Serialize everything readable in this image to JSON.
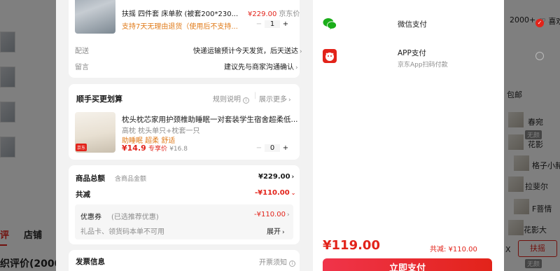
{
  "background": {
    "tabs": [
      "评",
      "店铺"
    ],
    "review_title": "织评价(2000+",
    "cart_count": "2000+",
    "like_label": "喜欢",
    "right_items": [
      "包邮",
      "春宛",
      "花影",
      "格子小赭",
      "拉斐尔",
      "F菩情",
      "花影",
      "无颜",
      "无颜",
      "无颜"
    ],
    "follow_button": "扶摇",
    "right_note": "花影大",
    "stray_char": "X"
  },
  "product": {
    "spec": "扶摇   四件套  床单款   (被套200*230...",
    "price": "¥229.00",
    "seller": "京东价",
    "return_policy": "支持7天无理由退货（使用后不支持...",
    "qty": "1",
    "minus": "−",
    "plus": "+",
    "delivery_label": "配送",
    "delivery_value": "快递运输预计今天发货，后天送达",
    "note_label": "留言",
    "note_value": "建议先与商家沟通确认"
  },
  "bundle": {
    "title": "顺手买更划算",
    "rules": "规则说明",
    "more": "展示更多",
    "name": "枕头枕芯家用护颈椎助睡眠一对套装学生宿舍超柔低...",
    "spec": "高枕  枕头单只+枕套一只",
    "tags": "助睡眠  超柔  舒适",
    "price": "¥14.9",
    "price_label": "专享价",
    "old_price": "¥16.8",
    "qty": "0",
    "minus": "−",
    "plus": "+",
    "tag": "京东"
  },
  "totals": {
    "goods_label": "商品总额",
    "goods_sub": "含商品金额",
    "goods_value": "¥229.00",
    "discount_label": "共减",
    "discount_value": "-¥110.00",
    "coupon_label": "优惠券",
    "coupon_sub": "(已选推荐优惠)",
    "coupon_value": "-¥110.00",
    "card_label": "礼品卡、领货码本单不可用",
    "card_action": "展开"
  },
  "invoice": {
    "label": "发票信息",
    "note": "开票须知"
  },
  "payment": {
    "methods": [
      {
        "name": "微信支付",
        "sub": ""
      },
      {
        "name": "APP支付",
        "sub": "京东App扫码付款"
      }
    ],
    "total": "¥119.00",
    "saved": "共减: ¥110.00",
    "pay_button": "立即支付"
  },
  "colors": {
    "accent": "#e2231a",
    "wechat": "#1aad19"
  }
}
